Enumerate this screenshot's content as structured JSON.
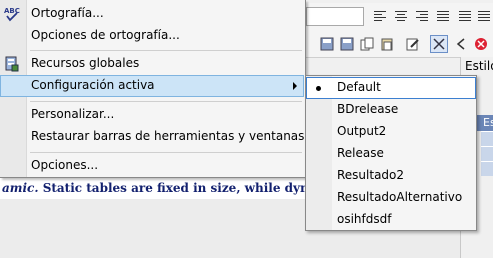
{
  "document": {
    "text_italic": "amic.",
    "text_rest": " Static tables are fixed in size, while dynamic tabl"
  },
  "side_panel": {
    "label": "Estilo",
    "header_fragment": "Es"
  },
  "menu": {
    "items": [
      {
        "label": "Ortografía...",
        "icon": "spell-check-icon"
      },
      {
        "label": "Opciones de ortografía..."
      },
      {
        "label": "Recursos globales",
        "icon": "global-resources-icon"
      },
      {
        "label": "Configuración activa",
        "submenu": true,
        "highlighted": true
      },
      {
        "label": "Personalizar..."
      },
      {
        "label": "Restaurar barras de herramientas y ventanas..."
      },
      {
        "label": "Opciones..."
      }
    ]
  },
  "submenu": {
    "items": [
      {
        "label": "Default",
        "checked": true
      },
      {
        "label": "BDrelease"
      },
      {
        "label": "Output2"
      },
      {
        "label": "Release"
      },
      {
        "label": "Resultado2"
      },
      {
        "label": "ResultadoAlternativo"
      },
      {
        "label": "osihfdsdf"
      }
    ]
  },
  "colors": {
    "menu_highlight": "#cce4f7",
    "submenu_highlight_border": "#3c7fd0",
    "doc_text": "#12206e"
  }
}
